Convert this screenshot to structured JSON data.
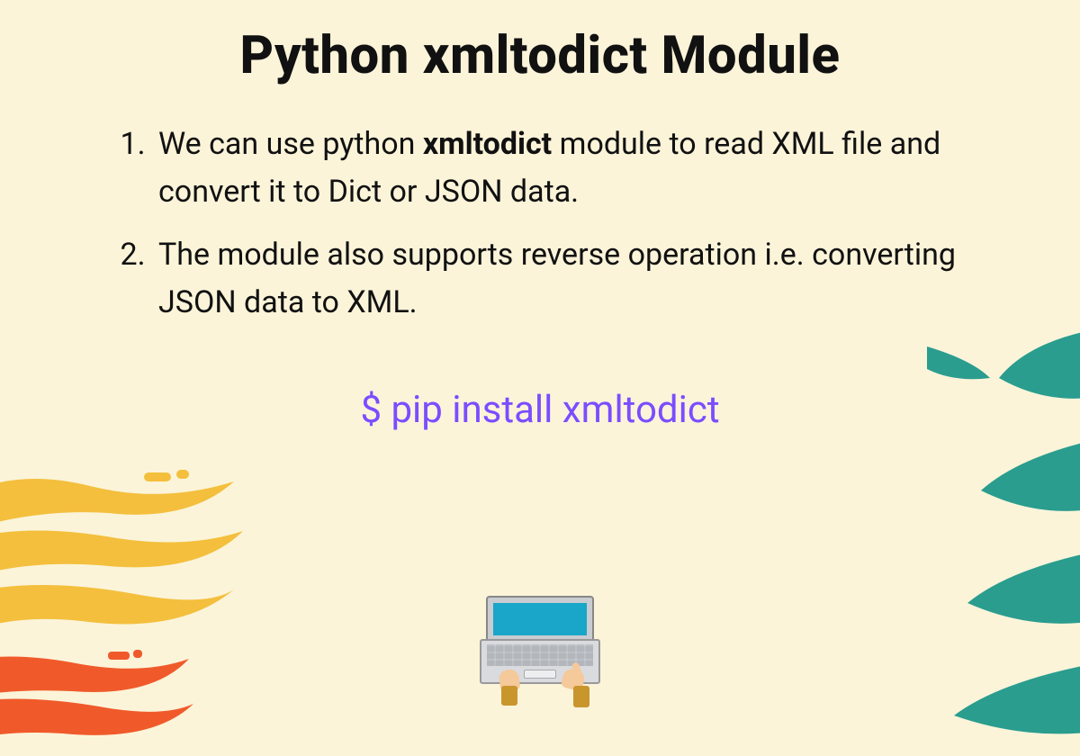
{
  "title": "Python xmltodict Module",
  "list": {
    "item1_pre": "We can use python ",
    "item1_bold": "xmltodict",
    "item1_post": " module to read XML file and convert it to Dict or JSON data.",
    "item2": "The module also supports reverse operation i.e. converting JSON data to XML."
  },
  "command": "$ pip install xmltodict",
  "colors": {
    "bg": "#fbf4d9",
    "command": "#7b4dff",
    "yellow_brush": "#f4bf3d",
    "orange_brush": "#f05a2a",
    "teal_squiggle": "#2a9d8f"
  },
  "icons": {
    "laptop": "laptop-hands-icon"
  }
}
